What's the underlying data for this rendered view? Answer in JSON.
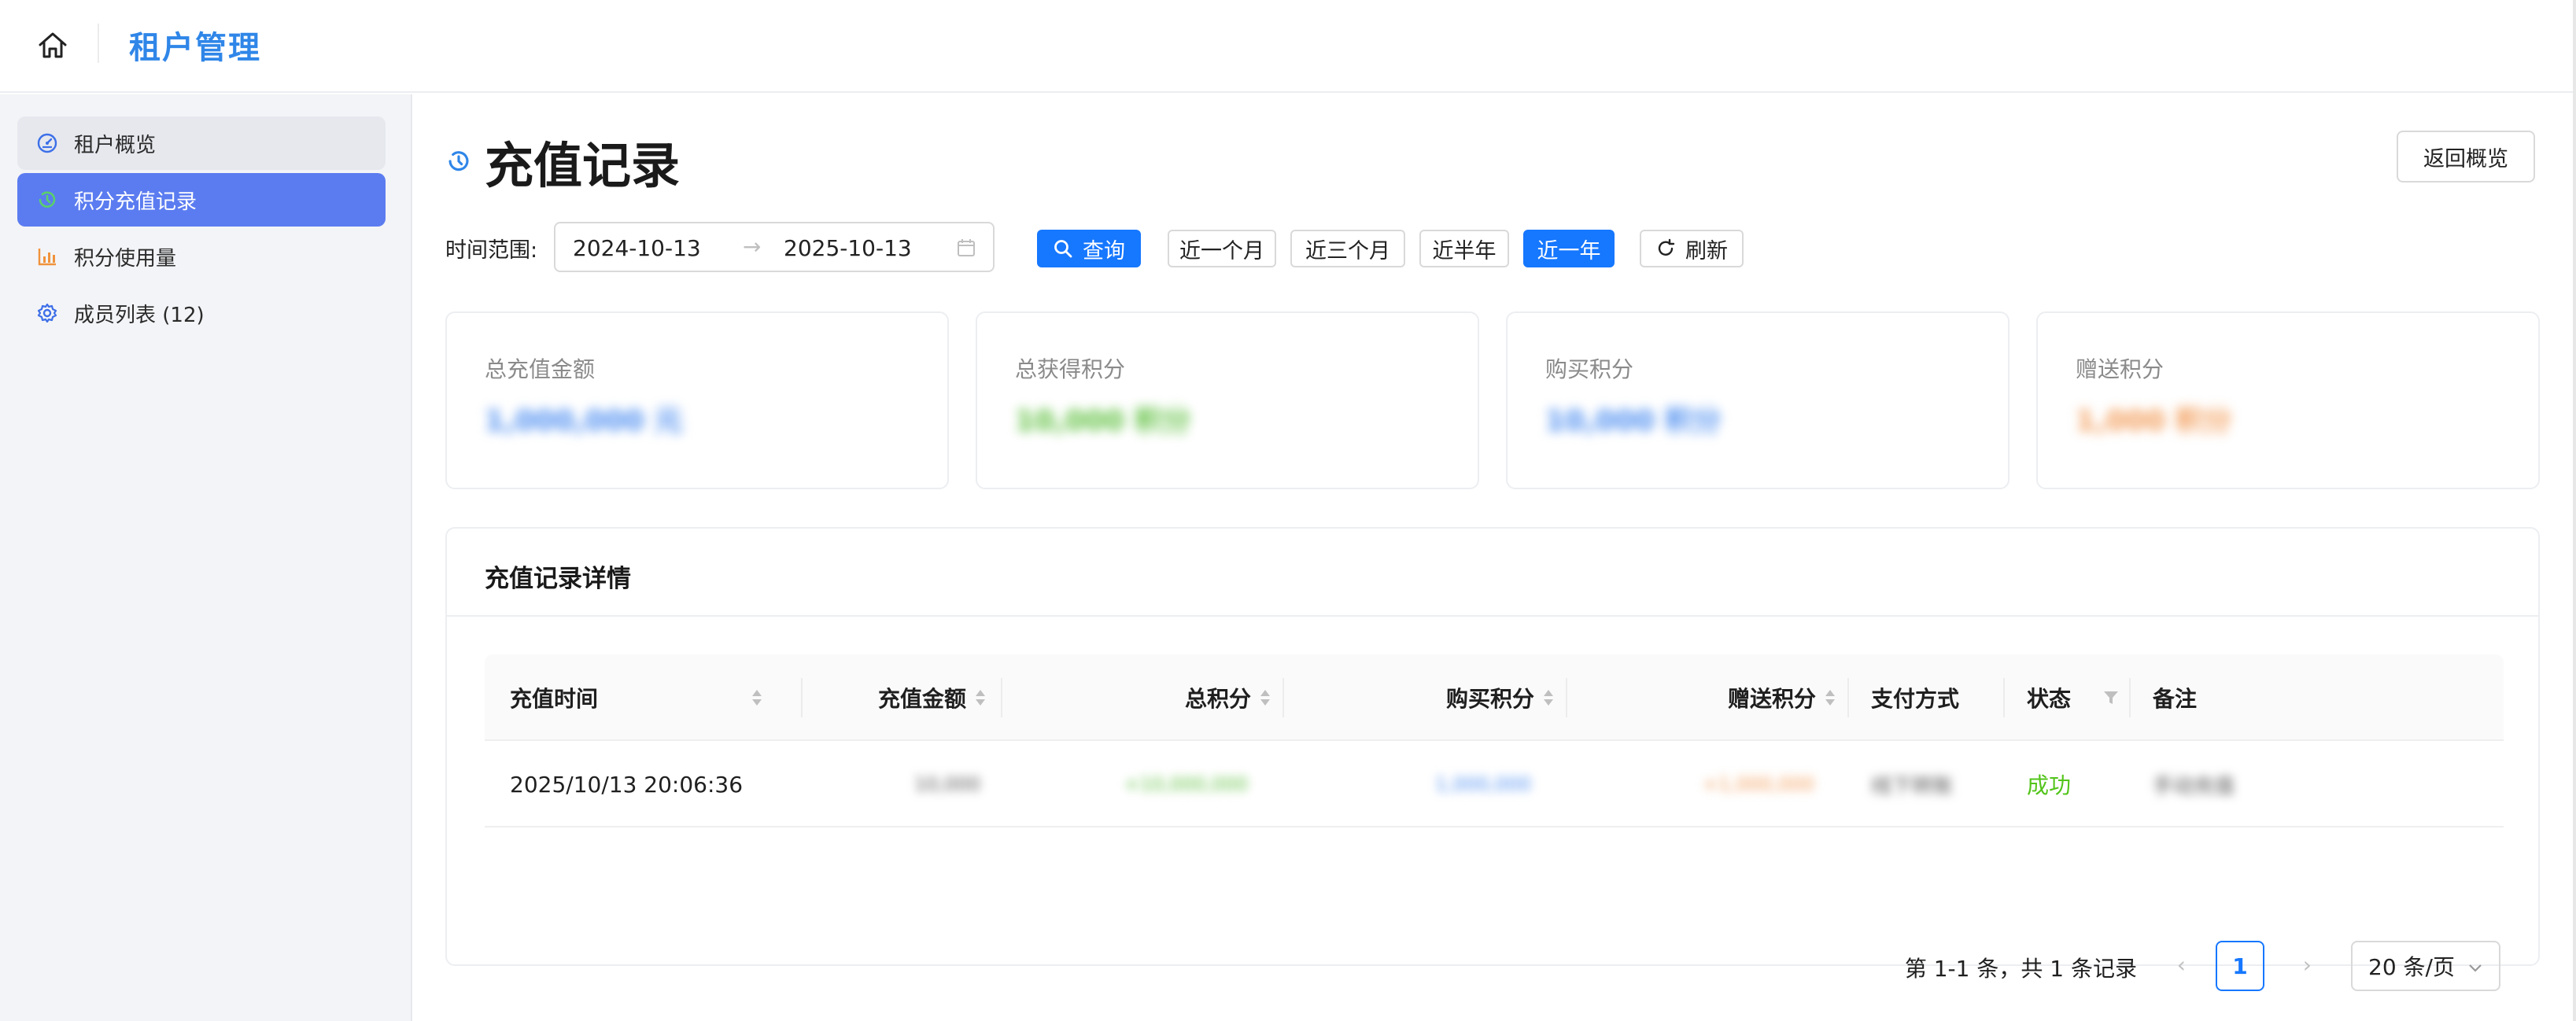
{
  "app": {
    "title": "租户管理"
  },
  "sidebar": {
    "items": [
      {
        "label": "租户概览",
        "icon": "dashboard-icon",
        "state": "hover"
      },
      {
        "label": "积分充值记录",
        "icon": "history-icon",
        "state": "active"
      },
      {
        "label": "积分使用量",
        "icon": "bar-chart-icon",
        "state": "normal"
      },
      {
        "label": "成员列表 (12)",
        "icon": "gear-icon",
        "state": "normal"
      }
    ]
  },
  "page": {
    "title": "充值记录",
    "back_label": "返回概览"
  },
  "filter": {
    "label": "时间范围:",
    "start_date": "2024-10-13",
    "end_date": "2025-10-13",
    "query_label": "查询",
    "quick_ranges": [
      "近一个月",
      "近三个月",
      "近半年",
      "近一年"
    ],
    "selected_range": "近一年",
    "refresh_label": "刷新"
  },
  "stats": [
    {
      "label": "总充值金额",
      "value": "1,000,000 元",
      "color": "#4a8cf0"
    },
    {
      "label": "总获得积分",
      "value": "10,000 积分",
      "color": "#5cbf3c"
    },
    {
      "label": "购买积分",
      "value": "10,000 积分",
      "color": "#4a8cf0"
    },
    {
      "label": "赠送积分",
      "value": "1,000 积分",
      "color": "#f29a55"
    }
  ],
  "detail": {
    "title": "充值记录详情",
    "columns": [
      "充值时间",
      "充值金额",
      "总积分",
      "购买积分",
      "赠送积分",
      "支付方式",
      "状态",
      "备注"
    ],
    "rows": [
      {
        "time": "2025/10/13 20:06:36",
        "amount": "10,000",
        "total_points": "+10,000,000",
        "purchase_points": "1,000,000",
        "gift_points": "+1,000,000",
        "payment": "线下转账",
        "status": "成功",
        "note": "手动充值"
      }
    ],
    "pagination": {
      "info": "第 1-1 条，共 1 条记录",
      "current_page": "1",
      "page_size": "20 条/页"
    }
  },
  "colors": {
    "accent": "#1677ff",
    "brand": "#2f86e8",
    "nav_active": "#5b7cf0",
    "success": "#52c41a"
  }
}
